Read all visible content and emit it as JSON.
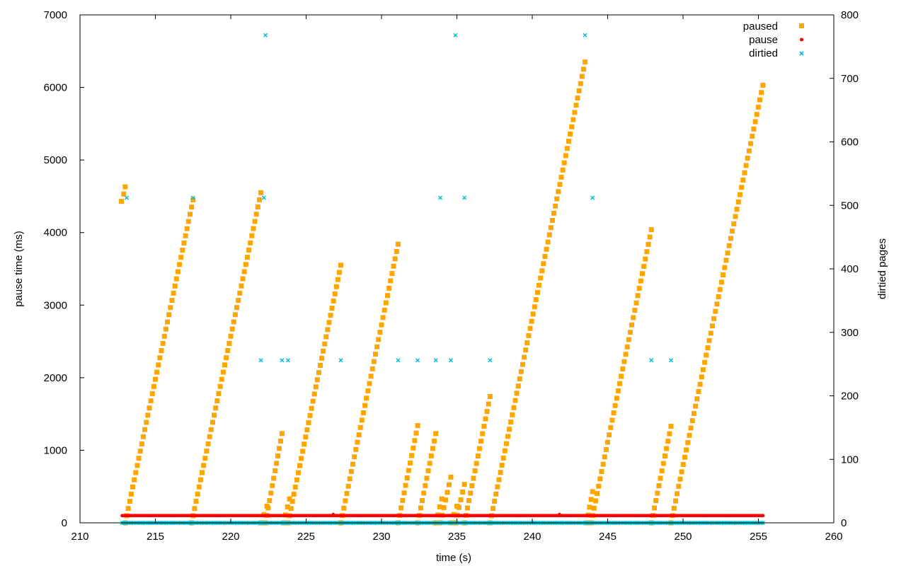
{
  "chart_data": {
    "type": "scatter",
    "title": "",
    "xlabel": "time (s)",
    "ylabel": "pause time (ms)",
    "y2label": "dirtied pages",
    "xlim": [
      210,
      260
    ],
    "ylim": [
      0,
      7000
    ],
    "y2lim": [
      0,
      800
    ],
    "xticks": [
      "210",
      "215",
      "220",
      "225",
      "230",
      "235",
      "240",
      "245",
      "250",
      "255",
      "260"
    ],
    "yticks": [
      "0",
      "1000",
      "2000",
      "3000",
      "4000",
      "5000",
      "6000",
      "7000"
    ],
    "y2ticks": [
      "0",
      "100",
      "200",
      "300",
      "400",
      "500",
      "600",
      "700",
      "800"
    ],
    "grid": false,
    "legend_position": "top-right",
    "series": [
      {
        "name": "paused",
        "axis": "y1",
        "color": "#ffa500",
        "marker": "square",
        "ramps": [
          {
            "t_start": 213.0,
            "t_end": 217.5,
            "y_start": 0,
            "y_end": 4450
          },
          {
            "t_start": 217.4,
            "t_end": 222.0,
            "y_start": 0,
            "y_end": 4550
          },
          {
            "t_start": 222.0,
            "t_end": 222.4,
            "y_start": 0,
            "y_end": 230
          },
          {
            "t_start": 222.3,
            "t_end": 223.4,
            "y_start": 0,
            "y_end": 1230
          },
          {
            "t_start": 223.5,
            "t_end": 223.9,
            "y_start": 0,
            "y_end": 330
          },
          {
            "t_start": 223.8,
            "t_end": 227.3,
            "y_start": 0,
            "y_end": 3550
          },
          {
            "t_start": 227.3,
            "t_end": 231.1,
            "y_start": 0,
            "y_end": 3840
          },
          {
            "t_start": 231.1,
            "t_end": 232.4,
            "y_start": 0,
            "y_end": 1340
          },
          {
            "t_start": 232.4,
            "t_end": 233.6,
            "y_start": 0,
            "y_end": 1230
          },
          {
            "t_start": 233.6,
            "t_end": 234.0,
            "y_start": 0,
            "y_end": 330
          },
          {
            "t_start": 233.9,
            "t_end": 234.6,
            "y_start": 0,
            "y_end": 630
          },
          {
            "t_start": 234.6,
            "t_end": 235.0,
            "y_start": 0,
            "y_end": 230
          },
          {
            "t_start": 234.9,
            "t_end": 235.5,
            "y_start": 0,
            "y_end": 530
          },
          {
            "t_start": 235.5,
            "t_end": 237.2,
            "y_start": 0,
            "y_end": 1740
          },
          {
            "t_start": 237.2,
            "t_end": 243.5,
            "y_start": 0,
            "y_end": 6350
          },
          {
            "t_start": 243.6,
            "t_end": 244.0,
            "y_start": 0,
            "y_end": 430
          },
          {
            "t_start": 243.9,
            "t_end": 247.9,
            "y_start": 0,
            "y_end": 4040
          },
          {
            "t_start": 247.9,
            "t_end": 249.2,
            "y_start": 0,
            "y_end": 1330
          },
          {
            "t_start": 249.2,
            "t_end": 255.3,
            "y_start": 0,
            "y_end": 6030
          }
        ],
        "extra_points": [
          {
            "x": 212.75,
            "y": 4430
          },
          {
            "x": 212.9,
            "y": 4530
          },
          {
            "x": 213.0,
            "y": 4630
          }
        ]
      },
      {
        "name": "pause",
        "axis": "y1",
        "color": "#ff0000",
        "marker": "circle",
        "description_values": {
          "t_start": 212.8,
          "t_end": 255.3,
          "y": 100,
          "step": 0.1
        },
        "spikes": [
          {
            "x": 226.8,
            "y": 115
          },
          {
            "x": 241.8,
            "y": 115
          }
        ]
      },
      {
        "name": "dirtied",
        "axis": "y2",
        "color": "#00bfcf",
        "marker": "x",
        "baseline": {
          "t_start": 212.8,
          "t_end": 255.3,
          "y": 0,
          "step": 0.1
        },
        "points": [
          {
            "x": 213.1,
            "y": 512
          },
          {
            "x": 217.5,
            "y": 512
          },
          {
            "x": 222.0,
            "y": 256
          },
          {
            "x": 222.2,
            "y": 512
          },
          {
            "x": 222.3,
            "y": 768
          },
          {
            "x": 223.4,
            "y": 256
          },
          {
            "x": 223.8,
            "y": 256
          },
          {
            "x": 227.3,
            "y": 256
          },
          {
            "x": 231.1,
            "y": 256
          },
          {
            "x": 232.4,
            "y": 256
          },
          {
            "x": 233.6,
            "y": 256
          },
          {
            "x": 233.9,
            "y": 512
          },
          {
            "x": 234.6,
            "y": 256
          },
          {
            "x": 234.9,
            "y": 768
          },
          {
            "x": 235.5,
            "y": 512
          },
          {
            "x": 237.2,
            "y": 256
          },
          {
            "x": 243.5,
            "y": 768
          },
          {
            "x": 244.0,
            "y": 512
          },
          {
            "x": 247.9,
            "y": 256
          },
          {
            "x": 249.2,
            "y": 256
          }
        ]
      }
    ]
  }
}
